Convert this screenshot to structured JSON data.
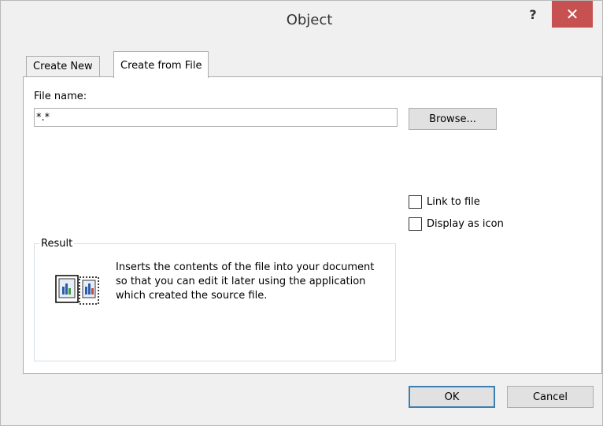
{
  "window": {
    "title": "Object",
    "help_symbol": "?",
    "close_symbol": "✕"
  },
  "tabs": [
    {
      "label": "Create New"
    },
    {
      "label": "Create from File"
    }
  ],
  "file_name": {
    "label": "File name:",
    "value": "*.*",
    "browse_label": "Browse..."
  },
  "options": {
    "link_to_file": {
      "label": "Link to file",
      "checked": false
    },
    "display_as_icon": {
      "label": "Display as icon",
      "checked": false
    }
  },
  "result": {
    "legend": "Result",
    "text": "Inserts the contents of the file into your document so that you can edit it later using the application which created the source file."
  },
  "footer": {
    "ok_label": "OK",
    "cancel_label": "Cancel"
  },
  "colors": {
    "close_button": "#c75050",
    "default_button_border": "#3c7fb1"
  }
}
